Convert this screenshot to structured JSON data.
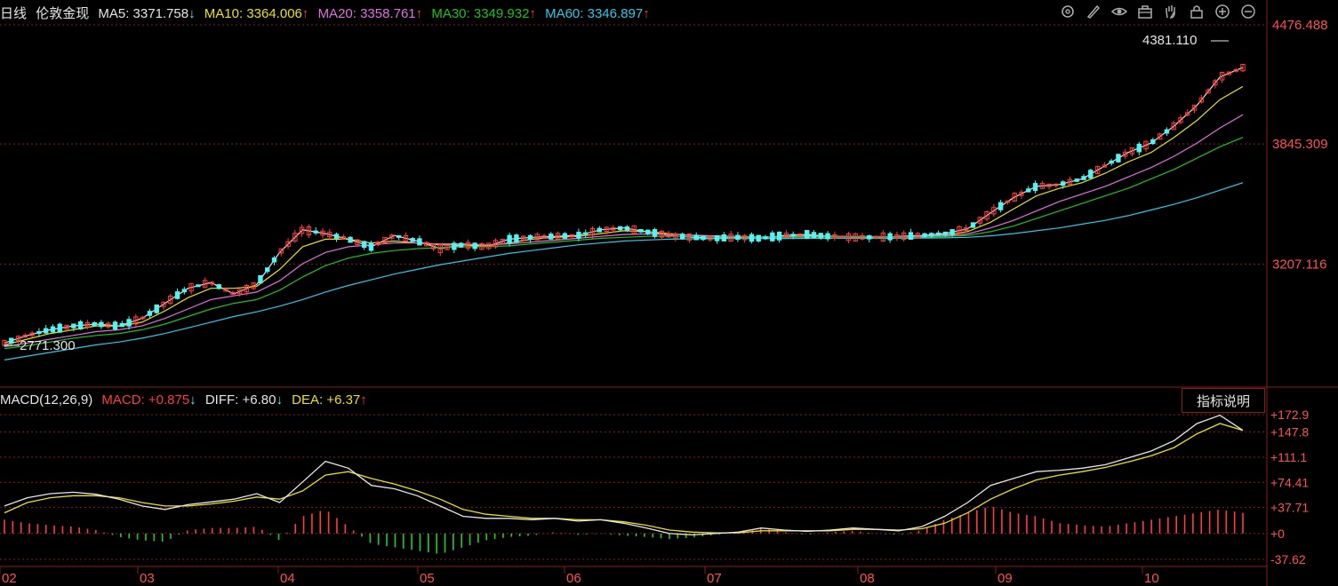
{
  "header": {
    "period": "日线",
    "instrument": "伦敦金现",
    "ma5": {
      "label": "MA5: 3371.758",
      "arrow": "↓",
      "color": "#e6e6e6"
    },
    "ma10": {
      "label": "MA10: 3364.006",
      "arrow": "↑",
      "color": "#e8e020"
    },
    "ma20": {
      "label": "MA20: 3358.761",
      "arrow": "↑",
      "color": "#e070e0"
    },
    "ma30": {
      "label": "MA30: 3349.932",
      "arrow": "↑",
      "color": "#20c020"
    },
    "ma60": {
      "label": "MA60: 3346.897",
      "arrow": "↑",
      "color": "#30c8e8"
    }
  },
  "toolbar": [
    "settings-icon",
    "pen-icon",
    "eye-icon",
    "briefcase-icon",
    "hand-icon",
    "lock-icon",
    "zoom-in-icon",
    "zoom-out-icon"
  ],
  "macd_header": {
    "name": "MACD(12,26,9)",
    "macd": "MACD: +0.875",
    "macd_arrow": "↓",
    "diff": "DIFF: +6.80",
    "diff_arrow": "↓",
    "dea": "DEA: +6.37",
    "dea_arrow": "↑"
  },
  "explain_button": "指标说明",
  "colors": {
    "up": "#ff3c3c",
    "down": "#54f2f2",
    "grid": "#8b1a1a",
    "axis_text": "#ff5050",
    "diff": "#e6e6e6",
    "dea": "#e8e020",
    "macd_up": "#ff3c3c",
    "macd_down": "#20d020"
  },
  "chart_data": {
    "type": "candlestick",
    "price_axis": {
      "ticks": [
        "4476.488",
        "3845.309",
        "3207.116"
      ],
      "ylim": [
        2771.3,
        4476.488
      ]
    },
    "macd_axis": {
      "ticks": [
        "+172.9",
        "+147.8",
        "+111.1",
        "+74.41",
        "+37.71",
        "+0",
        "-37.62"
      ],
      "ylim": [
        -37.62,
        172.9
      ]
    },
    "x_labels": [
      "02",
      "03",
      "04",
      "05",
      "06",
      "07",
      "08",
      "09",
      "10"
    ],
    "annotations": {
      "high": "4381.110",
      "low": "2771.300"
    },
    "series": [
      {
        "name": "MA5",
        "values": [
          2790,
          2830,
          2860,
          2880,
          2890,
          2880,
          2920,
          3000,
          3080,
          3110,
          3050,
          3100,
          3270,
          3390,
          3370,
          3340,
          3300,
          3360,
          3330,
          3290,
          3310,
          3300,
          3340,
          3350,
          3355,
          3360,
          3390,
          3400,
          3380,
          3360,
          3350,
          3345,
          3350,
          3345,
          3360,
          3365,
          3355,
          3350,
          3350,
          3355,
          3360,
          3370,
          3395,
          3480,
          3560,
          3620,
          3630,
          3660,
          3730,
          3800,
          3850,
          3940,
          4050,
          4200,
          4250
        ]
      },
      {
        "name": "MA10",
        "values": [
          2780,
          2810,
          2840,
          2860,
          2880,
          2880,
          2900,
          2960,
          3030,
          3080,
          3080,
          3090,
          3180,
          3300,
          3340,
          3340,
          3320,
          3330,
          3320,
          3310,
          3310,
          3305,
          3320,
          3340,
          3350,
          3355,
          3370,
          3385,
          3380,
          3370,
          3360,
          3355,
          3350,
          3348,
          3352,
          3358,
          3357,
          3353,
          3351,
          3352,
          3355,
          3362,
          3380,
          3430,
          3500,
          3570,
          3610,
          3640,
          3690,
          3750,
          3800,
          3880,
          3970,
          4080,
          4150
        ]
      },
      {
        "name": "MA20",
        "values": [
          2770,
          2790,
          2810,
          2830,
          2850,
          2860,
          2880,
          2920,
          2970,
          3020,
          3040,
          3060,
          3120,
          3210,
          3270,
          3300,
          3310,
          3320,
          3320,
          3315,
          3315,
          3310,
          3315,
          3325,
          3335,
          3345,
          3355,
          3365,
          3368,
          3366,
          3362,
          3358,
          3355,
          3352,
          3352,
          3354,
          3355,
          3355,
          3354,
          3353,
          3354,
          3358,
          3368,
          3400,
          3440,
          3490,
          3540,
          3580,
          3620,
          3670,
          3720,
          3780,
          3850,
          3930,
          4000
        ]
      },
      {
        "name": "MA30",
        "values": [
          2760,
          2775,
          2795,
          2815,
          2830,
          2840,
          2860,
          2890,
          2930,
          2970,
          3000,
          3020,
          3070,
          3140,
          3200,
          3240,
          3265,
          3280,
          3290,
          3295,
          3300,
          3300,
          3305,
          3315,
          3325,
          3335,
          3345,
          3350,
          3355,
          3356,
          3355,
          3353,
          3352,
          3350,
          3350,
          3351,
          3352,
          3352,
          3352,
          3351,
          3351,
          3354,
          3360,
          3380,
          3410,
          3450,
          3490,
          3530,
          3570,
          3610,
          3660,
          3710,
          3770,
          3830,
          3880
        ]
      },
      {
        "name": "MA60",
        "values": [
          2700,
          2720,
          2740,
          2760,
          2780,
          2795,
          2815,
          2840,
          2870,
          2900,
          2930,
          2955,
          2985,
          3020,
          3060,
          3095,
          3125,
          3155,
          3180,
          3205,
          3225,
          3245,
          3265,
          3280,
          3295,
          3310,
          3320,
          3330,
          3336,
          3340,
          3342,
          3343,
          3344,
          3344,
          3344,
          3345,
          3345,
          3345,
          3345,
          3345,
          3346,
          3347,
          3350,
          3358,
          3370,
          3385,
          3400,
          3420,
          3440,
          3465,
          3495,
          3525,
          3560,
          3600,
          3640
        ]
      }
    ],
    "macd": {
      "diff": [
        40,
        52,
        58,
        60,
        57,
        50,
        40,
        35,
        42,
        46,
        50,
        58,
        45,
        75,
        105,
        95,
        70,
        65,
        55,
        40,
        25,
        22,
        22,
        20,
        22,
        18,
        20,
        15,
        8,
        0,
        -2,
        0,
        2,
        8,
        5,
        3,
        5,
        8,
        6,
        4,
        10,
        25,
        45,
        70,
        80,
        90,
        92,
        95,
        100,
        110,
        120,
        135,
        160,
        172,
        150
      ],
      "dea": [
        30,
        45,
        52,
        55,
        55,
        52,
        45,
        40,
        40,
        43,
        47,
        53,
        50,
        62,
        85,
        90,
        80,
        72,
        62,
        50,
        35,
        28,
        25,
        22,
        22,
        20,
        20,
        17,
        12,
        5,
        2,
        1,
        1,
        4,
        4,
        4,
        4,
        6,
        6,
        5,
        7,
        15,
        30,
        50,
        65,
        78,
        85,
        90,
        96,
        104,
        113,
        125,
        145,
        160,
        150
      ],
      "hist": [
        20,
        15,
        12,
        10,
        5,
        -5,
        -10,
        -12,
        5,
        8,
        8,
        10,
        -10,
        25,
        35,
        10,
        -15,
        -20,
        -25,
        -30,
        -20,
        -10,
        -5,
        -3,
        2,
        -2,
        0,
        -3,
        -5,
        -8,
        -6,
        -2,
        2,
        8,
        2,
        -2,
        2,
        4,
        0,
        -2,
        5,
        20,
        30,
        40,
        30,
        25,
        15,
        12,
        10,
        15,
        20,
        25,
        30,
        35,
        30
      ]
    }
  }
}
